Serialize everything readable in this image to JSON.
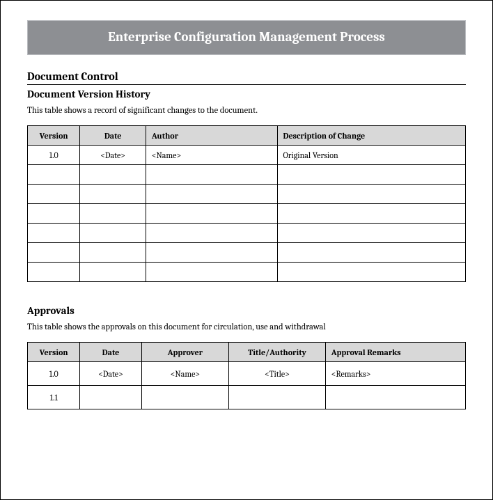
{
  "title": "Enterprise Configuration Management Process",
  "docControl": {
    "heading": "Document Control",
    "versionHistory": {
      "heading": "Document Version History",
      "caption": "This table shows a record of significant changes to the document.",
      "headers": {
        "version": "Version",
        "date": "Date",
        "author": "Author",
        "desc": "Description of Change"
      },
      "rows": [
        {
          "version": "1.0",
          "date": "<Date>",
          "author": "<Name>",
          "desc": "Original Version"
        },
        {
          "version": "",
          "date": "",
          "author": "",
          "desc": ""
        },
        {
          "version": "",
          "date": "",
          "author": "",
          "desc": ""
        },
        {
          "version": "",
          "date": "",
          "author": "",
          "desc": ""
        },
        {
          "version": "",
          "date": "",
          "author": "",
          "desc": ""
        },
        {
          "version": "",
          "date": "",
          "author": "",
          "desc": ""
        },
        {
          "version": "",
          "date": "",
          "author": "",
          "desc": ""
        }
      ]
    },
    "approvals": {
      "heading": "Approvals",
      "caption": "This table shows the approvals on this document for circulation, use and withdrawal",
      "headers": {
        "version": "Version",
        "date": "Date",
        "approver": "Approver",
        "title": "Title/Authority",
        "remarks": "Approval Remarks"
      },
      "rows": [
        {
          "version": "1.0",
          "date": "<Date>",
          "approver": "<Name>",
          "title": "<Title>",
          "remarks": "<Remarks>"
        },
        {
          "version": "1.1",
          "date": "",
          "approver": "",
          "title": "",
          "remarks": ""
        }
      ]
    }
  }
}
